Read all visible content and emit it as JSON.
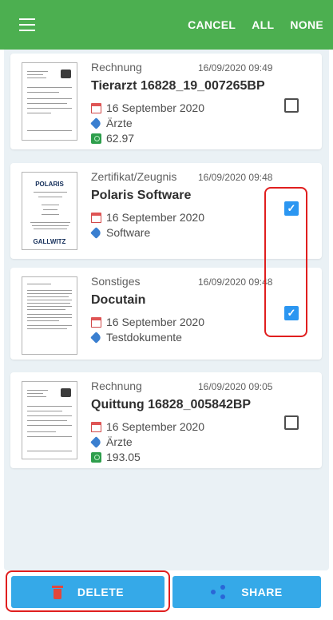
{
  "appbar": {
    "menu_icon": "hamburger-menu-icon",
    "cancel_label": "CANCEL",
    "all_label": "ALL",
    "none_label": "NONE",
    "color": "#4caf50"
  },
  "documents": [
    {
      "category": "Rechnung",
      "datetime": "16/09/2020 09:49",
      "title": "Tierarzt 16828_19_007265BP",
      "date": "16 September 2020",
      "tag": "Ärzte",
      "amount": "62.97",
      "checked": false
    },
    {
      "category": "Zertifikat/Zeugnis",
      "datetime": "16/09/2020 09:48",
      "title": "Polaris Software",
      "date": "16 September 2020",
      "tag": "Software",
      "checked": true,
      "thumb_top_text": "POLARIS",
      "thumb_bottom_text": "GALLWITZ"
    },
    {
      "category": "Sonstiges",
      "datetime": "16/09/2020 09:48",
      "title": "Docutain",
      "date": "16 September 2020",
      "tag": "Testdokumente",
      "checked": true
    },
    {
      "category": "Rechnung",
      "datetime": "16/09/2020 09:05",
      "title": "Quittung 16828_005842BP",
      "date": "16 September 2020",
      "tag": "Ärzte",
      "amount": "193.05",
      "checked": false
    }
  ],
  "footer": {
    "delete_label": "DELETE",
    "share_label": "SHARE",
    "button_color": "#35a9e8",
    "delete_icon": "trash-icon",
    "share_icon": "share-icon"
  },
  "highlight_color": "#e01e1e"
}
